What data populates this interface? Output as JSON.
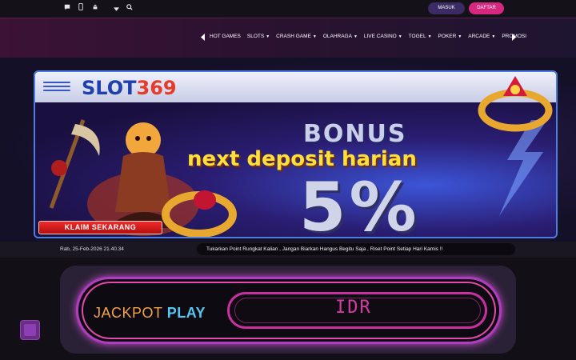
{
  "topbar": {
    "icons": [
      "chat-icon",
      "mobile-icon",
      "android-icon",
      "dropdown-icon",
      "search-icon"
    ],
    "masuk_label": "MASUK",
    "daftar_label": "DAFTAR"
  },
  "nav": {
    "items": [
      {
        "label": "HOT GAMES",
        "has_caret": false
      },
      {
        "label": "SLOTS",
        "has_caret": true
      },
      {
        "label": "CRASH GAME",
        "has_caret": true
      },
      {
        "label": "OLAHRAGA",
        "has_caret": true
      },
      {
        "label": "LIVE CASINO",
        "has_caret": true
      },
      {
        "label": "TOGEL",
        "has_caret": true
      },
      {
        "label": "POKER",
        "has_caret": true
      },
      {
        "label": "ARCADE",
        "has_caret": true
      },
      {
        "label": "PROMOSI",
        "has_caret": false
      }
    ]
  },
  "banner": {
    "logo_part1": "SLOT",
    "logo_part2": "369",
    "bonus": "BONUS",
    "headline": "next deposit harian",
    "percent": "5%",
    "cta": "KLAIM SEKARANG"
  },
  "info": {
    "datetime": "Rab, 25-Feb-2026 21.40.34",
    "marquee": "Tukarkan Point Rungkat Kalian , Jangan Biarkan Hangus Begitu Saja , Riset Point Setiap Hari Kamis !!"
  },
  "jackpot": {
    "label_word1": "JACKPOT",
    "label_word2": "PLAY",
    "currency": "IDR"
  },
  "colors": {
    "accent_pink": "#d6287f",
    "accent_purple": "#3b2a63",
    "jackpot_orange": "#f3a248",
    "jackpot_blue": "#55c7f3"
  }
}
